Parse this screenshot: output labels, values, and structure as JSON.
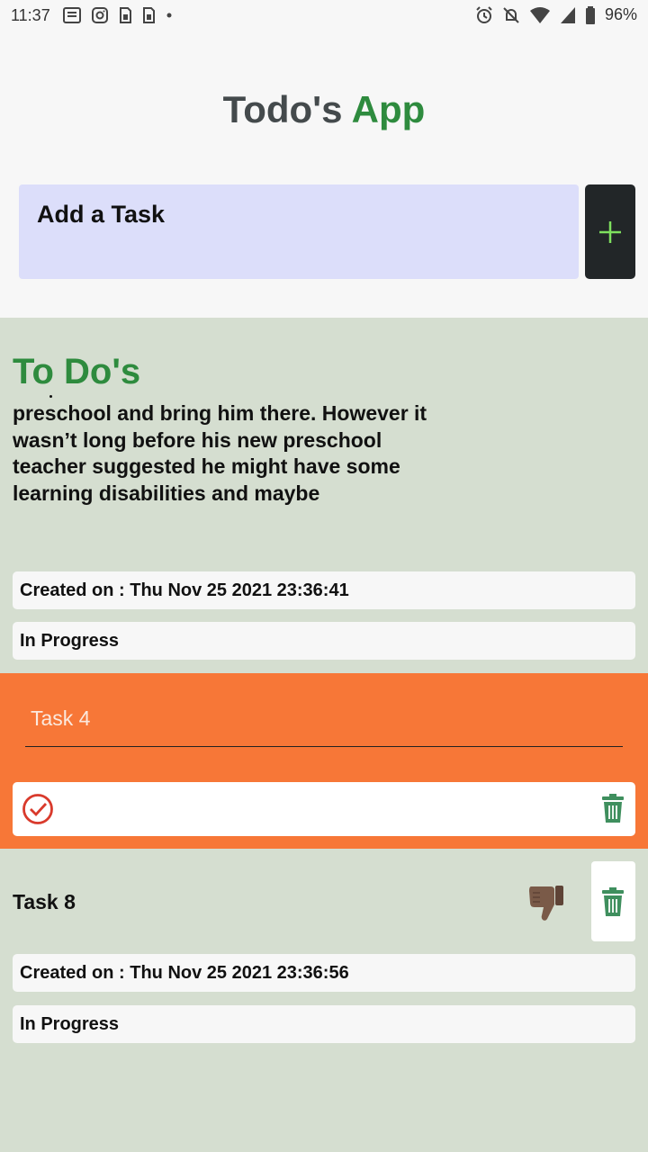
{
  "status_bar": {
    "time": "11:37",
    "battery": "96%",
    "left_icons": [
      "news-icon",
      "instagram-icon",
      "sim-icon",
      "sim-icon"
    ],
    "right_icons": [
      "alarm-icon",
      "notifications-off-icon",
      "wifi-icon",
      "signal-icon",
      "battery-icon"
    ]
  },
  "header": {
    "title_part1": "Todo's",
    "title_part2": "App"
  },
  "add_task": {
    "placeholder": "Add a Task",
    "button_icon": "plus-icon"
  },
  "colors": {
    "accent_green": "#2e8b3e",
    "section_bg": "#d5ded0",
    "edit_bg": "#f77737",
    "input_bg": "#dcdefa"
  },
  "section": {
    "title": "To Do's"
  },
  "tasks": [
    {
      "text": "preschool and bring him there. However it wasn’t long before his new preschool teacher suggested he might have some learning disabilities and maybe",
      "created": "Created on : Thu Nov 25 2021 23:36:41",
      "status": "In Progress"
    },
    {
      "edit_value": "Task 4",
      "actions": [
        "check-circle-icon",
        "trash-icon"
      ]
    },
    {
      "name": "Task 8",
      "reaction_icon": "thumbs-down-icon",
      "created": "Created on : Thu Nov 25 2021 23:36:56",
      "status": "In Progress"
    }
  ]
}
